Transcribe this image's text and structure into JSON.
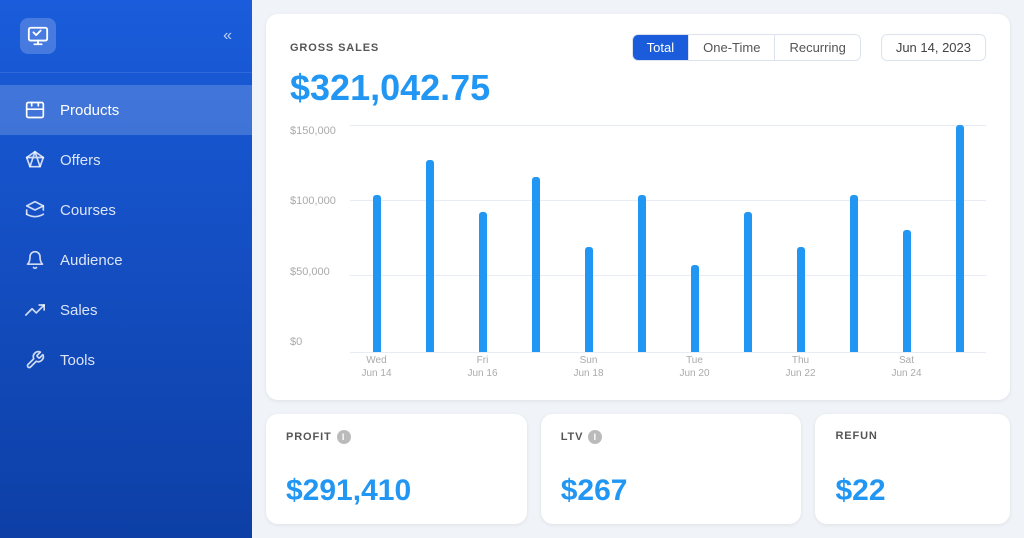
{
  "sidebar": {
    "logo_alt": "App Logo",
    "collapse_label": "«",
    "items": [
      {
        "id": "products",
        "label": "Products",
        "icon": "tag",
        "active": true
      },
      {
        "id": "offers",
        "label": "Offers",
        "icon": "diamond",
        "active": false
      },
      {
        "id": "courses",
        "label": "Courses",
        "icon": "mortarboard",
        "active": false
      },
      {
        "id": "audience",
        "label": "Audience",
        "icon": "bell",
        "active": false
      },
      {
        "id": "sales",
        "label": "Sales",
        "icon": "trending-up",
        "active": false
      },
      {
        "id": "tools",
        "label": "Tools",
        "icon": "wrench",
        "active": false
      }
    ]
  },
  "grossSales": {
    "title": "GROSS SALES",
    "amount": "$321,042.75",
    "filters": [
      {
        "label": "Total",
        "active": true
      },
      {
        "label": "One-Time",
        "active": false
      },
      {
        "label": "Recurring",
        "active": false
      }
    ],
    "date": "Jun 14, 2023",
    "yLabels": [
      "$150,000",
      "$100,000",
      "$50,000",
      "$0"
    ],
    "xLabels": [
      {
        "line1": "Wed",
        "line2": "Jun 14"
      },
      {
        "line1": "",
        "line2": ""
      },
      {
        "line1": "Fri",
        "line2": "Jun 16"
      },
      {
        "line1": "",
        "line2": ""
      },
      {
        "line1": "Sun",
        "line2": "Jun 18"
      },
      {
        "line1": "",
        "line2": ""
      },
      {
        "line1": "Tue",
        "line2": "Jun 20"
      },
      {
        "line1": "",
        "line2": ""
      },
      {
        "line1": "Thu",
        "line2": "Jun 22"
      },
      {
        "line1": "",
        "line2": ""
      },
      {
        "line1": "Sat",
        "line2": "Jun 24"
      },
      {
        "line1": "",
        "line2": ""
      }
    ],
    "bars": [
      45,
      55,
      40,
      50,
      30,
      45,
      25,
      40,
      30,
      45,
      35,
      65
    ]
  },
  "stats": [
    {
      "id": "profit",
      "label": "PROFIT",
      "value": "$291,410",
      "hasInfo": true
    },
    {
      "id": "ltv",
      "label": "LTV",
      "value": "$267",
      "hasInfo": true
    },
    {
      "id": "refund",
      "label": "REFUN",
      "value": "$22",
      "hasInfo": false,
      "partial": true
    }
  ]
}
